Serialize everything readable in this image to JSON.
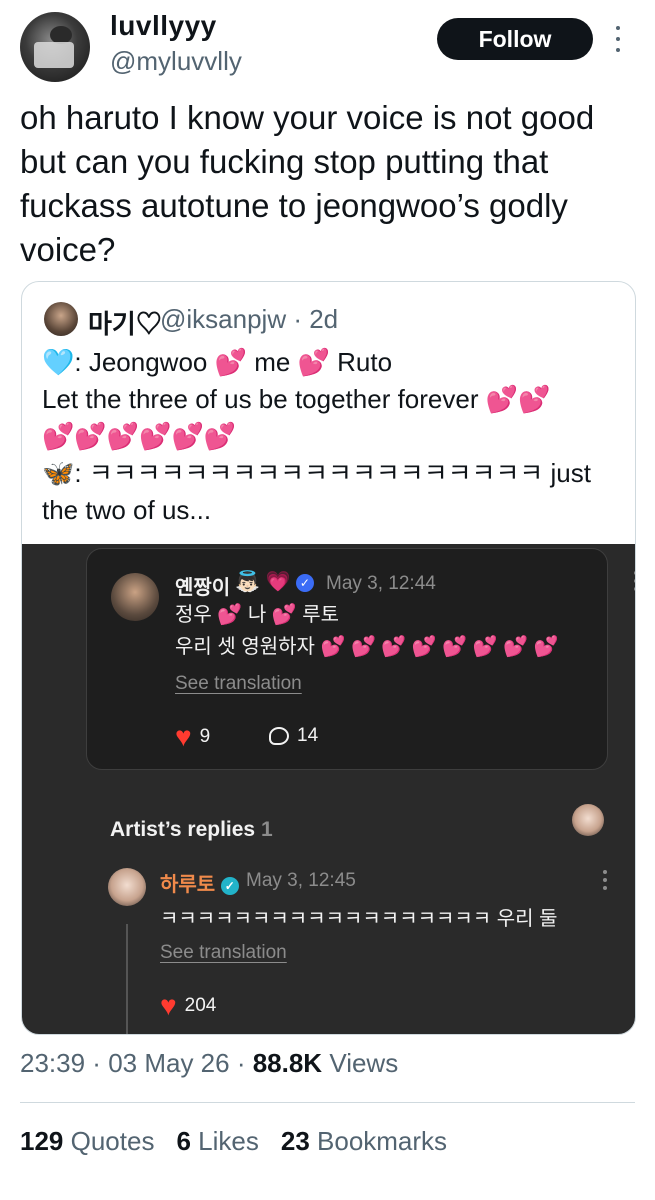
{
  "author": {
    "name": "luvllyyy",
    "handle": "@myluvvlly",
    "follow_label": "Follow"
  },
  "tweet": {
    "text": "oh haruto I know your voice is not good but can you fucking stop putting that fuckass autotune to jeongwoo’s godly voice?"
  },
  "quote": {
    "name": "마기♡",
    "handle": "@iksanpjw",
    "age": "· 2d",
    "line1_a": ": Jeongwoo ",
    "line1_b": " me ",
    "line1_c": " Ruto",
    "line2": "Let the three of us be together forever ",
    "line4": ": ㅋㅋㅋㅋㅋㅋㅋㅋㅋㅋㅋㅋㅋㅋㅋㅋㅋㅋㅋ just the two of us...",
    "hearts": "💕",
    "heart_row": "💕💕💕💕💕💕",
    "heart_pair": "💕💕",
    "light_heart": "🩵",
    "butterfly": "🦋"
  },
  "screenshot": {
    "comment": {
      "name": "옌짱이",
      "emoji1": "👼🏻",
      "emoji2": "💗",
      "time": "May 3, 12:44",
      "body1_a": "정우 ",
      "body1_b": " 나 ",
      "body1_c": " 루토",
      "body2": "우리 셋 영원하자 ",
      "hearts8": "💕 💕 💕 💕 💕 💕 💕 💕",
      "see_translation": "See translation",
      "likes": "9",
      "replies": "14"
    },
    "artist_replies": {
      "title": "Artist’s replies",
      "count": "1"
    },
    "reply": {
      "name": "하루토",
      "time": "May 3, 12:45",
      "body": "ㅋㅋㅋㅋㅋㅋㅋㅋㅋㅋㅋㅋㅋㅋㅋㅋㅋㅋ 우리 둘",
      "see_translation": "See translation",
      "likes": "204"
    }
  },
  "meta": {
    "time": "23:39",
    "date": "03 May 26",
    "views": "88.8K",
    "views_label": "Views"
  },
  "stats": {
    "quotes_count": "129",
    "quotes_label": "Quotes",
    "likes_count": "6",
    "likes_label": "Likes",
    "bookmarks_count": "23",
    "bookmarks_label": "Bookmarks"
  },
  "colors": {
    "brand_text": "#0f1419",
    "secondary_text": "#536471",
    "dark_bg": "#2a2a2a",
    "accent_pink": "#ff2fa8",
    "like_red": "#ff3b30"
  }
}
